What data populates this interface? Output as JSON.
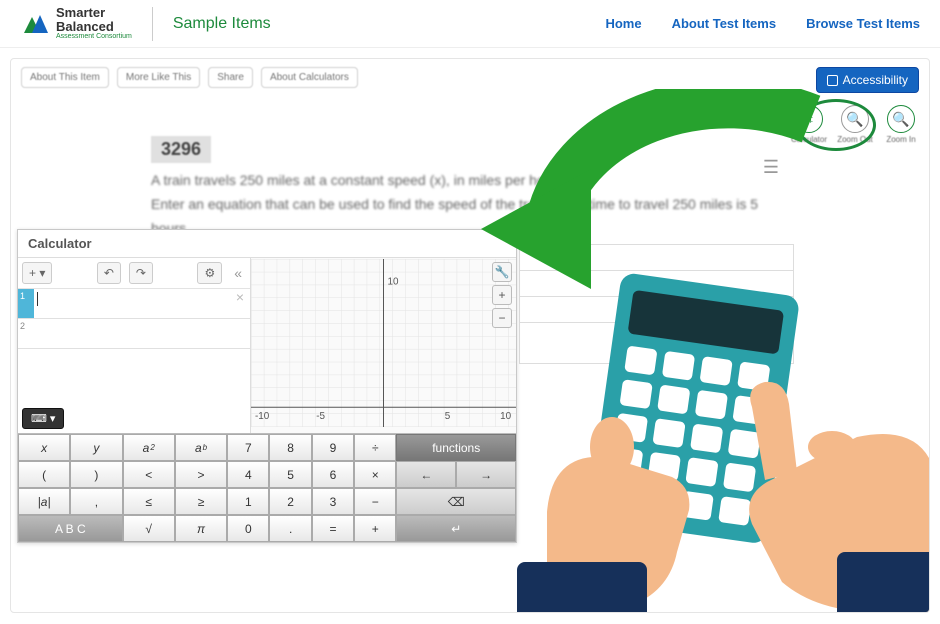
{
  "header": {
    "logo_l1": "Smarter",
    "logo_l2": "Balanced",
    "logo_l3": "Assessment Consortium",
    "brand": "Sample Items",
    "nav": [
      "Home",
      "About Test Items",
      "Browse Test Items"
    ]
  },
  "toolbar": {
    "pills": [
      "About This Item",
      "More Like This",
      "Share",
      "About Calculators"
    ],
    "accessibility": "Accessibility"
  },
  "tools": {
    "items": [
      {
        "name": "calculator",
        "label": "Calculator",
        "glyph": "▦"
      },
      {
        "name": "zoomout",
        "label": "Zoom Out",
        "glyph": "−"
      },
      {
        "name": "zoomin",
        "label": "Zoom In",
        "glyph": "+"
      }
    ]
  },
  "question": {
    "number": "3296",
    "line1": "A train travels 250 miles at a constant speed (x), in miles per hour.",
    "line2": "Enter an equation that can be used to find the speed of the train, if the time to travel 250 miles is 5 hours."
  },
  "calc": {
    "title": "Calculator",
    "row1_num": "1",
    "row2_num": "2",
    "axis": {
      "xmin": "-10",
      "xneg5": "-5",
      "x5": "5",
      "x10": "10",
      "y10": "10"
    },
    "funcbtn": "functions",
    "abc": "A B C",
    "keys_a": [
      "x",
      "y",
      "a²",
      "aᵇ",
      "(",
      ")",
      "<",
      ">",
      "|a|",
      ",",
      "≤",
      "≥",
      "A B C",
      "",
      "√",
      "π"
    ],
    "keys_b": [
      "7",
      "8",
      "9",
      "÷",
      "4",
      "5",
      "6",
      "×",
      "1",
      "2",
      "3",
      "−",
      "0",
      ".",
      "=",
      "+"
    ],
    "arrows": {
      "left": "←",
      "right": "→",
      "back": "⌫",
      "enter": "↵"
    }
  }
}
